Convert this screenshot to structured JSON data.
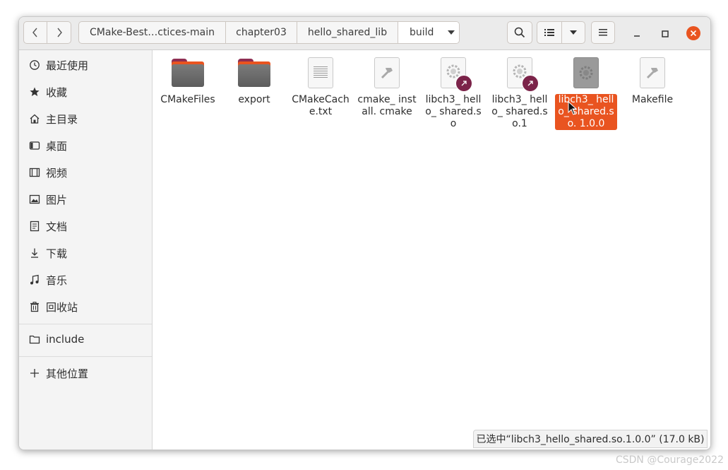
{
  "headerbar": {
    "back_icon": "chevron-left-icon",
    "forward_icon": "chevron-right-icon",
    "breadcrumbs": [
      "CMake-Best…ctices-main",
      "chapter03",
      "hello_shared_lib",
      "build"
    ],
    "search_icon": "search-icon",
    "view_list_icon": "list-view-icon",
    "view_dropdown_icon": "chevron-down-icon",
    "menu_icon": "hamburger-menu-icon",
    "minimize_icon": "minimize-icon",
    "maximize_icon": "maximize-icon",
    "close_icon": "close-icon",
    "close_color": "#e95420"
  },
  "sidebar": {
    "items": [
      {
        "label": "最近使用",
        "icon": "clock-icon"
      },
      {
        "label": "收藏",
        "icon": "star-icon"
      },
      {
        "label": "主目录",
        "icon": "home-icon"
      },
      {
        "label": "桌面",
        "icon": "desktop-icon"
      },
      {
        "label": "视频",
        "icon": "video-icon"
      },
      {
        "label": "图片",
        "icon": "image-icon"
      },
      {
        "label": "文档",
        "icon": "document-icon"
      },
      {
        "label": "下载",
        "icon": "download-icon"
      },
      {
        "label": "音乐",
        "icon": "music-icon"
      },
      {
        "label": "回收站",
        "icon": "trash-icon"
      }
    ],
    "bookmarks": [
      {
        "label": "include",
        "icon": "folder-icon"
      }
    ],
    "other_locations": {
      "label": "其他位置",
      "icon": "plus-icon"
    }
  },
  "files": [
    {
      "name": "CMakeFiles",
      "type": "folder"
    },
    {
      "name": "export",
      "type": "folder"
    },
    {
      "name": "CMakeCach e.txt",
      "type": "text"
    },
    {
      "name": "cmake_ install. cmake",
      "type": "script"
    },
    {
      "name": "libch3_ hello_ shared.so",
      "type": "library-link"
    },
    {
      "name": "libch3_ hello_ shared.so.1",
      "type": "library-link"
    },
    {
      "name": "libch3_ hello_ shared.so. 1.0.0",
      "type": "library",
      "selected": true
    },
    {
      "name": "Makefile",
      "type": "script"
    }
  ],
  "status": "已选中“libch3_hello_shared.so.1.0.0” (17.0 kB)",
  "watermark": "CSDN @Courage2022",
  "colors": {
    "accent": "#e95420",
    "link_badge": "#7b2349"
  }
}
